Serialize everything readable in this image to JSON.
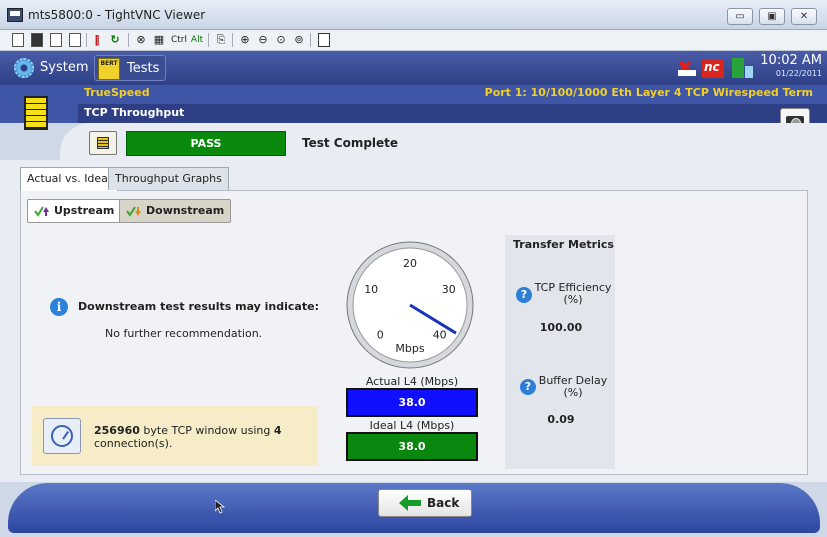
{
  "window": {
    "title": "mts5800:0 - TightVNC Viewer",
    "minimize_glyph": "▭",
    "maximize_glyph": "▣",
    "close_glyph": "✕"
  },
  "toolbar": {
    "ctrl_label": "Ctrl",
    "alt_label": "Alt"
  },
  "nav": {
    "system_label": "System",
    "tests_label": "Tests",
    "tests_icon_text": "BERT"
  },
  "clock": {
    "time": "10:02 AM",
    "date": "01/22/2011"
  },
  "status_icons": {
    "nc_label": "nc"
  },
  "header": {
    "app_name": "TrueSpeed",
    "test_name": "TCP Throughput",
    "port_info": "Port 1: 10/100/1000 Eth Layer 4 TCP Wirespeed Term"
  },
  "status": {
    "result": "PASS",
    "message": "Test Complete"
  },
  "tabs": [
    {
      "label": "Actual vs. Ideal",
      "active": true
    },
    {
      "label": "Throughput Graphs",
      "active": false
    }
  ],
  "direction": {
    "upstream_label": "Upstream",
    "downstream_label": "Downstream"
  },
  "recommendation": {
    "title": "Downstream test results may indicate:",
    "text": "No further recommendation."
  },
  "tcp_window": {
    "bytes": "256960",
    "middle_text": " byte TCP window using ",
    "connections": "4",
    "end_text": " connection(s)."
  },
  "gauge": {
    "unit": "Mbps",
    "min": 0,
    "max": 40,
    "ticks": [
      "0",
      "10",
      "20",
      "30",
      "40"
    ],
    "needle_value": 38.0
  },
  "actual": {
    "label": "Actual L4 (Mbps)",
    "value": "38.0"
  },
  "ideal": {
    "label": "Ideal L4 (Mbps)",
    "value": "38.0"
  },
  "metrics": {
    "title": "Transfer Metrics",
    "tcp_efficiency_label": "TCP Efficiency (%)",
    "tcp_efficiency_value": "100.00",
    "buffer_delay_label": "Buffer Delay (%)",
    "buffer_delay_value": "0.09"
  },
  "footer": {
    "back_label": "Back"
  },
  "colors": {
    "pass_green": "#098a0d",
    "actual_blue": "#1010ff",
    "ideal_green": "#09870e",
    "header_yellow": "#f1cf2b",
    "nav_blue": "#2d3f85"
  }
}
